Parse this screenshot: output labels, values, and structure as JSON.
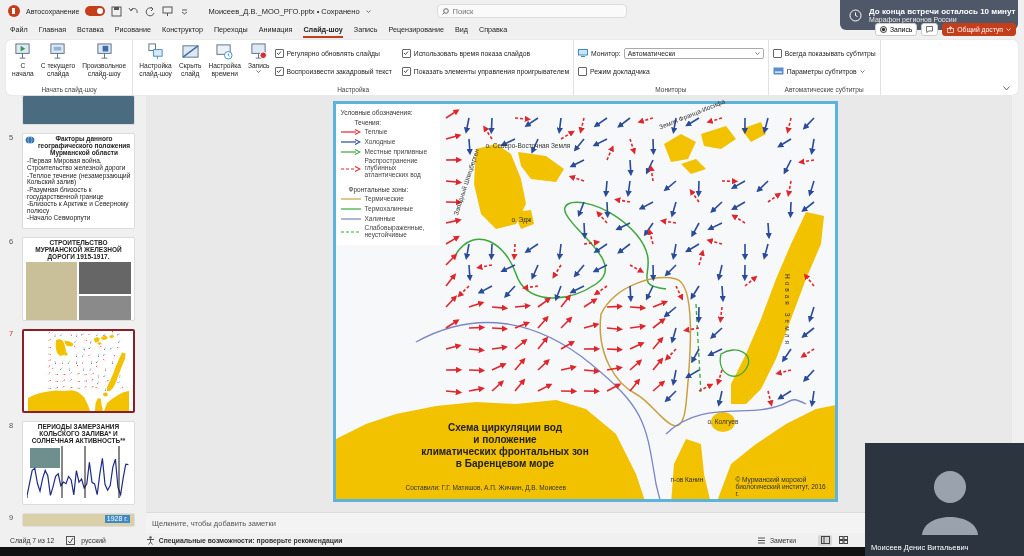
{
  "title_bar": {
    "autosave_label": "Автосохранение",
    "autosave_on": true,
    "file_name": "Моисеев_Д.В._МОО_РГО.pptx • Сохранено",
    "search_placeholder": "Поиск"
  },
  "notification": {
    "title": "До конца встречи осталось 10 минут",
    "subtitle": "Марафон регионов России"
  },
  "tabs": [
    {
      "label": "Файл",
      "selected": false
    },
    {
      "label": "Главная",
      "selected": false
    },
    {
      "label": "Вставка",
      "selected": false
    },
    {
      "label": "Рисование",
      "selected": false
    },
    {
      "label": "Конструктор",
      "selected": false
    },
    {
      "label": "Переходы",
      "selected": false
    },
    {
      "label": "Анимация",
      "selected": false
    },
    {
      "label": "Слайд-шоу",
      "selected": true
    },
    {
      "label": "Запись",
      "selected": false
    },
    {
      "label": "Рецензирование",
      "selected": false
    },
    {
      "label": "Вид",
      "selected": false
    },
    {
      "label": "Справка",
      "selected": false
    }
  ],
  "header_buttons": {
    "record": "Запись",
    "share": "Общий доступ"
  },
  "ribbon_groups": [
    {
      "label": "Начать слайд-шоу",
      "buttons": [
        {
          "kind": "play",
          "label": "С\nначала",
          "has_menu": false
        },
        {
          "kind": "current",
          "label": "С текущего\nслайда",
          "has_menu": false
        },
        {
          "kind": "custom",
          "label": "Произвольное\nслайд-шоу",
          "has_menu": true
        }
      ]
    },
    {
      "label": "Настройка",
      "buttons": [
        {
          "kind": "setup",
          "label": "Настройка\nслайд-шоу",
          "has_menu": false
        },
        {
          "kind": "hide",
          "label": "Скрыть\nслайд",
          "has_menu": false
        },
        {
          "kind": "timing",
          "label": "Настройка\nвремени",
          "has_menu": false
        },
        {
          "kind": "record",
          "label": "Запись",
          "has_menu": true
        }
      ],
      "options": [
        {
          "kind": "checkbox",
          "label": "Регулярно обновлять слайды",
          "checked": true
        },
        {
          "kind": "checkbox",
          "label": "Воспроизвести закадровый текст",
          "checked": true
        },
        {
          "kind": "checkbox",
          "label": "Использовать время показа слайдов",
          "checked": true
        },
        {
          "kind": "checkbox",
          "label": "Показать элементы управления проигрывателем",
          "checked": true
        }
      ]
    },
    {
      "label": "Мониторы",
      "options": [
        {
          "kind": "dropdown",
          "label": "Монитор:",
          "value": "Автоматически"
        },
        {
          "kind": "checkbox",
          "label": "Режим докладчика",
          "checked": false
        }
      ]
    },
    {
      "label": "Автоматические субтитры",
      "options": [
        {
          "kind": "checkbox",
          "label": "Всегда показывать субтитры",
          "checked": false
        },
        {
          "kind": "menu",
          "label": "Параметры субтитров"
        }
      ]
    }
  ],
  "thumbnails": [
    {
      "kind": "photo",
      "selected": false
    },
    {
      "number": "5",
      "kind": "text",
      "selected": false,
      "title": "Факторы данного географического положения Мурманской области",
      "lines": [
        "-Первая Мировая война. Строительство железной дороги",
        "-Теплое течение (незамерзающий Кольский залив)",
        "-Разумная близость к государственной границе",
        "-Близость к Арктике и Северному полюсу",
        "-Начало Севморпути"
      ]
    },
    {
      "number": "6",
      "kind": "photos",
      "selected": false,
      "title": "СТРОИТЕЛЬСТВО МУРМАНСКОЙ ЖЕЛЕЗНОЙ ДОРОГИ 1915-1917."
    },
    {
      "number": "7",
      "kind": "map",
      "selected": true
    },
    {
      "number": "8",
      "kind": "chart",
      "selected": false,
      "title": "ПЕРИОДЫ ЗАМЕРЗАНИЯ КОЛЬСКОГО ЗАЛИВА* И СОЛНЕЧНАЯ АКТИВНОСТЬ**"
    },
    {
      "number": "9",
      "kind": "partial_map",
      "selected": false,
      "badge": "1928 г."
    }
  ],
  "slide": {
    "legend": {
      "title": "Условные обозначения:",
      "currents_heading": "Течения:",
      "currents": [
        {
          "kind": "warm",
          "label": "Теплые"
        },
        {
          "kind": "cold",
          "label": "Холодные"
        },
        {
          "kind": "tidal",
          "label": "Местные приливные"
        },
        {
          "kind": "deep",
          "label": "Распространение глубинных атлантических вод"
        }
      ],
      "fronts_heading": "Фронтальные зоны:",
      "fronts": [
        {
          "kind": "thermal",
          "label": "Термические"
        },
        {
          "kind": "thermohaline",
          "label": "Термохалинные"
        },
        {
          "kind": "haline",
          "label": "Халинные"
        },
        {
          "kind": "weak",
          "label": "Слабовыраженные, неустойчивые"
        }
      ]
    },
    "places": [
      {
        "kind": "franz_josef",
        "label": "Земля Франца-Иосифа"
      },
      {
        "kind": "ne_land",
        "label": "о. Северо-Восточная Земля"
      },
      {
        "kind": "spitsbergen",
        "label": "Западный Шпицберген"
      },
      {
        "kind": "edge",
        "label": "о. Эдж"
      },
      {
        "kind": "novaya_zemlya",
        "label": "Новая Земля"
      },
      {
        "kind": "kolguev",
        "label": "о. Колгуев"
      },
      {
        "kind": "kanin",
        "label": "п-ов Канин"
      }
    ],
    "title": "Схема циркуляции вод\nи положение\nклиматических фронтальных зон\nв Баренцевом море",
    "authors": "Составили: Г.Г. Матишов, А.П. Жичкин, Д.В. Моисеев",
    "copyright": "© Мурманский морской биологический институт, 2016 г."
  },
  "notes_placeholder": "Щелкните, чтобы добавить заметки",
  "status_bar": {
    "slide_counter": "Слайд 7 из 12",
    "language": "русский",
    "accessibility": "Специальные возможности: проверьте рекомендации",
    "notes": "Заметки",
    "views": [
      {
        "kind": "normal",
        "selected": true
      },
      {
        "kind": "sorter",
        "selected": false
      }
    ]
  },
  "video": {
    "name": "Моисеев Денис Витальевич"
  }
}
